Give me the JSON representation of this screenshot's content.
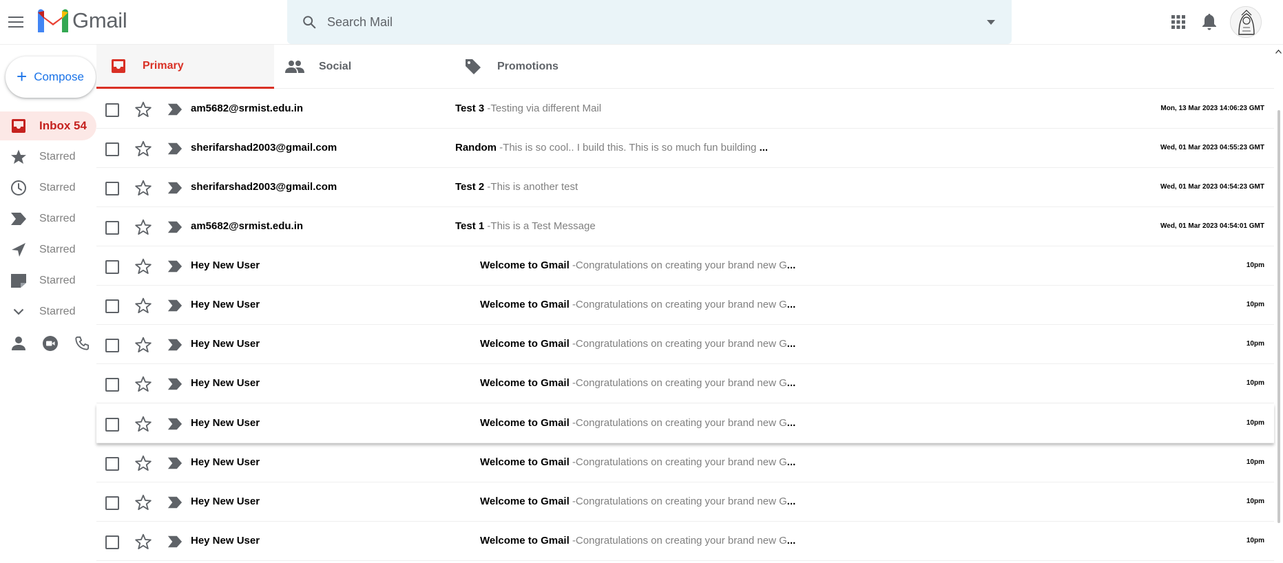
{
  "header": {
    "app_name": "Gmail",
    "search_placeholder": "Search Mail"
  },
  "sidebar": {
    "compose_label": "Compose",
    "items": [
      {
        "label": "Inbox 54",
        "icon": "inbox-icon",
        "active": true
      },
      {
        "label": "Starred",
        "icon": "star-icon"
      },
      {
        "label": "Starred",
        "icon": "clock-icon"
      },
      {
        "label": "Starred",
        "icon": "label-icon"
      },
      {
        "label": "Starred",
        "icon": "send-icon"
      },
      {
        "label": "Starred",
        "icon": "note-icon"
      },
      {
        "label": "Starred",
        "icon": "chevron-down-icon"
      }
    ]
  },
  "tabs": [
    {
      "label": "Primary",
      "icon": "inbox-icon",
      "active": true
    },
    {
      "label": "Social",
      "icon": "people-icon"
    },
    {
      "label": "Promotions",
      "icon": "tag-icon"
    }
  ],
  "emails": [
    {
      "sender": "am5682@srmist.edu.in",
      "subject": "Test 3",
      "snippet": "-Testing via different Mail",
      "ellipsis": "",
      "time": "Mon, 13 Mar 2023 14:06:23 GMT"
    },
    {
      "sender": "sherifarshad2003@gmail.com",
      "subject": "Random",
      "snippet": "-This is so cool.. I build this. This is so much fun building ",
      "ellipsis": "...",
      "time": "Wed, 01 Mar 2023 04:55:23 GMT"
    },
    {
      "sender": "sherifarshad2003@gmail.com",
      "subject": "Test 2",
      "snippet": "-This is another test",
      "ellipsis": "",
      "time": "Wed, 01 Mar 2023 04:54:23 GMT"
    },
    {
      "sender": "am5682@srmist.edu.in",
      "subject": "Test 1",
      "snippet": "-This is a Test Message",
      "ellipsis": "",
      "time": "Wed, 01 Mar 2023 04:54:01 GMT"
    },
    {
      "sender": "Hey New User",
      "subject": "Welcome to Gmail",
      "snippet": "-Congratulations on creating your brand new G",
      "ellipsis": "...",
      "time": "10pm"
    },
    {
      "sender": "Hey New User",
      "subject": "Welcome to Gmail",
      "snippet": "-Congratulations on creating your brand new G",
      "ellipsis": "...",
      "time": "10pm"
    },
    {
      "sender": "Hey New User",
      "subject": "Welcome to Gmail",
      "snippet": "-Congratulations on creating your brand new G",
      "ellipsis": "...",
      "time": "10pm"
    },
    {
      "sender": "Hey New User",
      "subject": "Welcome to Gmail",
      "snippet": "-Congratulations on creating your brand new G",
      "ellipsis": "...",
      "time": "10pm"
    },
    {
      "sender": "Hey New User",
      "subject": "Welcome to Gmail",
      "snippet": "-Congratulations on creating your brand new G",
      "ellipsis": "...",
      "time": "10pm"
    },
    {
      "sender": "Hey New User",
      "subject": "Welcome to Gmail",
      "snippet": "-Congratulations on creating your brand new G",
      "ellipsis": "...",
      "time": "10pm"
    },
    {
      "sender": "Hey New User",
      "subject": "Welcome to Gmail",
      "snippet": "-Congratulations on creating your brand new G",
      "ellipsis": "...",
      "time": "10pm"
    },
    {
      "sender": "Hey New User",
      "subject": "Welcome to Gmail",
      "snippet": "-Congratulations on creating your brand new G",
      "ellipsis": "...",
      "time": "10pm"
    }
  ],
  "colors": {
    "accent_red": "#d93025",
    "active_nav_bg": "#fce8e6",
    "search_bg": "#eaf4f8",
    "compose_blue": "#1a73e8"
  }
}
